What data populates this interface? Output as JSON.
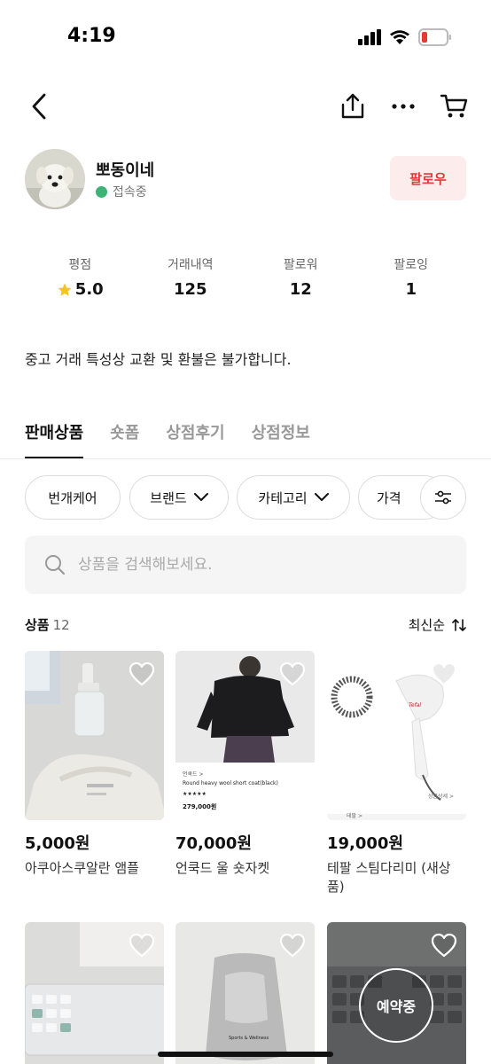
{
  "status": {
    "time": "4:19"
  },
  "profile": {
    "name": "뽀동이네",
    "online_label": "접속중",
    "follow_label": "팔로우"
  },
  "stats": [
    {
      "label": "평점",
      "value": "5.0"
    },
    {
      "label": "거래내역",
      "value": "125"
    },
    {
      "label": "팔로워",
      "value": "12"
    },
    {
      "label": "팔로잉",
      "value": "1"
    }
  ],
  "notice": "중고 거래 특성상 교환 및 환불은 불가합니다.",
  "tabs": [
    {
      "label": "판매상품",
      "active": true
    },
    {
      "label": "숏폼",
      "active": false
    },
    {
      "label": "상점후기",
      "active": false
    },
    {
      "label": "상점정보",
      "active": false
    }
  ],
  "filters": [
    "번개케어",
    "브랜드",
    "카테고리",
    "가격"
  ],
  "search": {
    "placeholder": "상품을 검색해보세요."
  },
  "products_header": {
    "label": "상품",
    "count": "12",
    "sort_label": "최신순"
  },
  "products": [
    {
      "price": "5,000원",
      "title": "아쿠아스쿠알란 앰플"
    },
    {
      "price": "70,000원",
      "title": "언쿡드 울 숏자켓"
    },
    {
      "price": "19,000원",
      "title": "테팔 스팀다리미 (새상품)"
    },
    {
      "price": "",
      "title": ""
    },
    {
      "price": "",
      "title": ""
    },
    {
      "price": "",
      "title": "",
      "badge": "예약중"
    }
  ],
  "thumb_text": {
    "p2_brand": "언쿡드 >",
    "p2_name": "Round heavy wool short coat(black)",
    "p2_stars": "★★★★★",
    "p2_price": "279,000원",
    "p3_brand": "Tefal",
    "p3_label": "상품상세 >",
    "p3_tag": "테팔 >",
    "p5_text": "Sports & Wellness"
  },
  "colors": {
    "accent": "#e03a3a",
    "follow_bg": "#fdecec",
    "online": "#3cb478",
    "star": "#f5c518"
  }
}
